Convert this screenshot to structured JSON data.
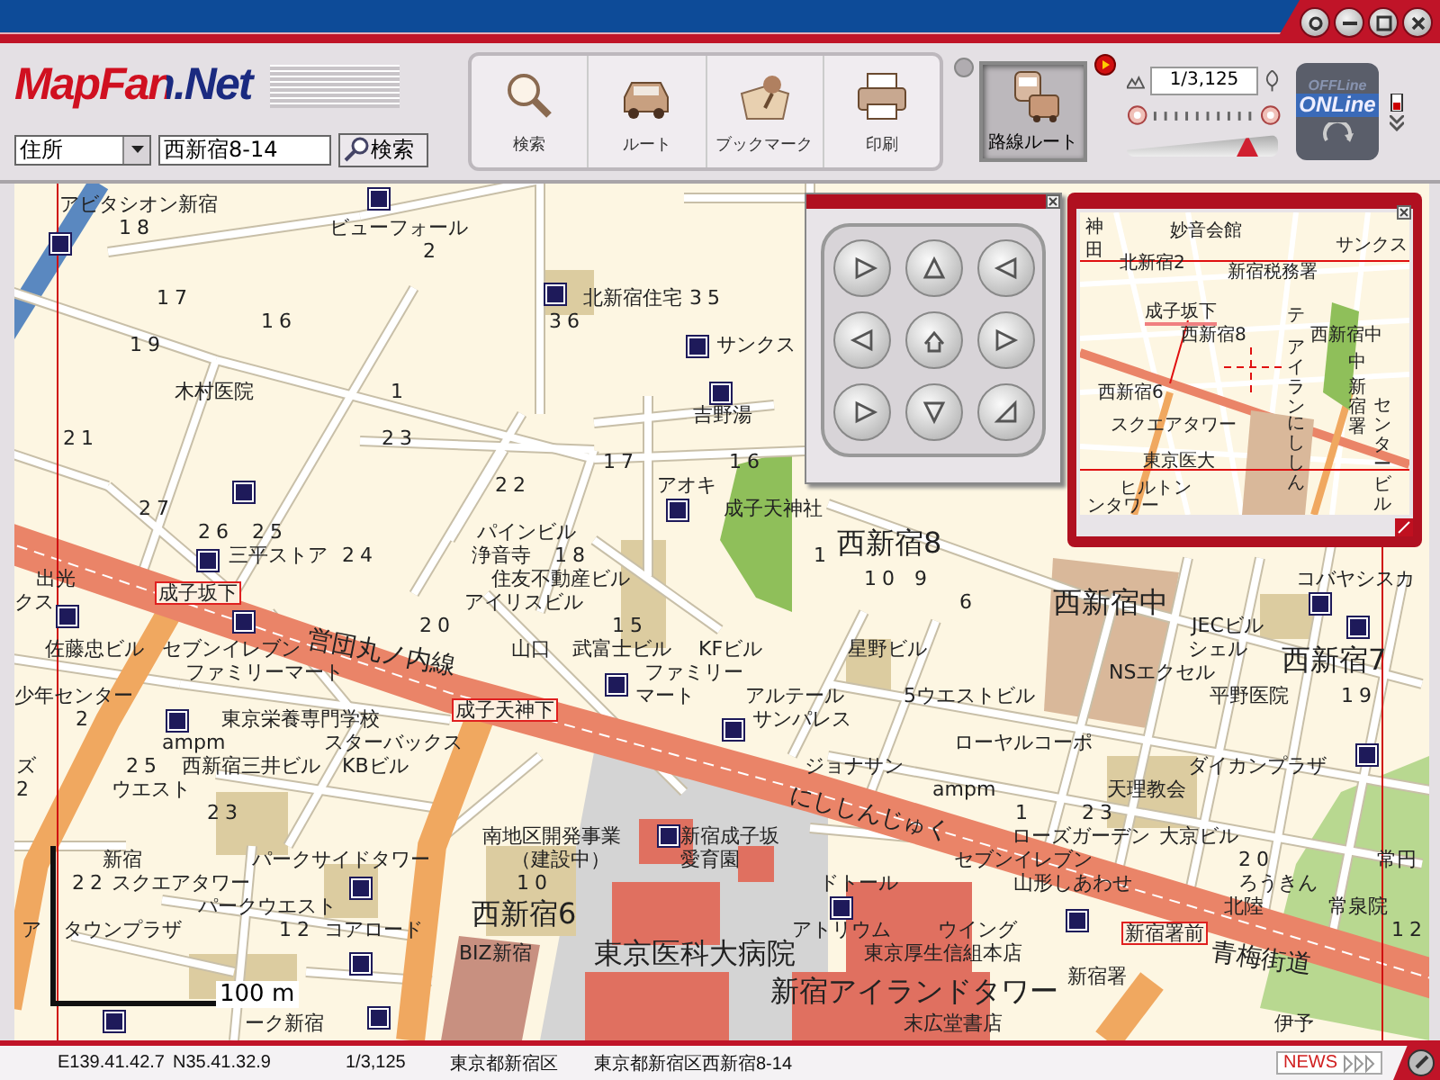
{
  "toolbar": {
    "logo": "MapFan.Net",
    "search_type": "住所",
    "address": "西新宿8-14",
    "search_button": "検索",
    "tools": [
      {
        "label": "検索",
        "kind": "search",
        "selected": false
      },
      {
        "label": "ルート",
        "kind": "route",
        "selected": false
      },
      {
        "label": "ブックマーク",
        "kind": "bookmark",
        "selected": false
      },
      {
        "label": "印刷",
        "kind": "print",
        "selected": false
      },
      {
        "label": "路線ルート",
        "kind": "transit",
        "selected": true
      }
    ],
    "scale": "1/3,125",
    "zoom_slider": {
      "level": 0.8
    },
    "mode_badge": {
      "top": "OFFLine",
      "bottom": "ONLine"
    }
  },
  "map": {
    "labels": [
      {
        "text": "アビタシオン新宿",
        "kind": "place"
      },
      {
        "text": "18",
        "kind": "number"
      },
      {
        "text": "ビューフォール",
        "kind": "place"
      },
      {
        "text": "2",
        "kind": "number"
      },
      {
        "text": "17",
        "kind": "number"
      },
      {
        "text": "北新宿住宅",
        "kind": "place"
      },
      {
        "text": "35",
        "kind": "number"
      },
      {
        "text": "16",
        "kind": "number"
      },
      {
        "text": "36",
        "kind": "number"
      },
      {
        "text": "19",
        "kind": "number"
      },
      {
        "text": "サンクス",
        "kind": "place"
      },
      {
        "text": "木村医院",
        "kind": "place"
      },
      {
        "text": "1",
        "kind": "number"
      },
      {
        "text": "吉野湯",
        "kind": "place"
      },
      {
        "text": "21",
        "kind": "number"
      },
      {
        "text": "23",
        "kind": "number"
      },
      {
        "text": "17",
        "kind": "number"
      },
      {
        "text": "16",
        "kind": "number"
      },
      {
        "text": "22",
        "kind": "number"
      },
      {
        "text": "アオキ",
        "kind": "place"
      },
      {
        "text": "27",
        "kind": "number"
      },
      {
        "text": "成子天神社",
        "kind": "place"
      },
      {
        "text": "26",
        "kind": "number"
      },
      {
        "text": "25",
        "kind": "number"
      },
      {
        "text": "パインビル",
        "kind": "place"
      },
      {
        "text": "三平ストア",
        "kind": "place"
      },
      {
        "text": "24",
        "kind": "number"
      },
      {
        "text": "浄音寺",
        "kind": "place"
      },
      {
        "text": "18",
        "kind": "number"
      },
      {
        "text": "1",
        "kind": "number"
      },
      {
        "text": "出光",
        "kind": "place"
      },
      {
        "text": "住友不動産ビル",
        "kind": "place"
      },
      {
        "text": "10",
        "kind": "number"
      },
      {
        "text": "9",
        "kind": "number"
      },
      {
        "text": "コバヤシスカ",
        "kind": "place"
      },
      {
        "text": "クス",
        "kind": "place"
      },
      {
        "text": "アイリスビル",
        "kind": "place"
      },
      {
        "text": "6",
        "kind": "number"
      },
      {
        "text": "20",
        "kind": "number"
      },
      {
        "text": "15",
        "kind": "number"
      },
      {
        "text": "JECビル",
        "kind": "place"
      },
      {
        "text": "佐藤忠ビル",
        "kind": "place"
      },
      {
        "text": "セブンイレブン",
        "kind": "place"
      },
      {
        "text": "山口",
        "kind": "place"
      },
      {
        "text": "武富士ビル",
        "kind": "place"
      },
      {
        "text": "KFビル",
        "kind": "place"
      },
      {
        "text": "星野ビル",
        "kind": "place"
      },
      {
        "text": "シェル",
        "kind": "place"
      },
      {
        "text": "ファミリーマート",
        "kind": "place"
      },
      {
        "text": "ファミリー",
        "kind": "place"
      },
      {
        "text": "NSエクセル",
        "kind": "place"
      },
      {
        "text": "少年センター",
        "kind": "place"
      },
      {
        "text": "マート",
        "kind": "place"
      },
      {
        "text": "アルテール",
        "kind": "place"
      },
      {
        "text": "5ウエストビル",
        "kind": "place"
      },
      {
        "text": "平野医院",
        "kind": "place"
      },
      {
        "text": "19",
        "kind": "number"
      },
      {
        "text": "2",
        "kind": "number"
      },
      {
        "text": "東京栄養専門学校",
        "kind": "place"
      },
      {
        "text": "サンパレス",
        "kind": "place"
      },
      {
        "text": "ampm",
        "kind": "place"
      },
      {
        "text": "スターバックス",
        "kind": "place"
      },
      {
        "text": "ローヤルコーポ",
        "kind": "place"
      },
      {
        "text": "ズ",
        "kind": "place"
      },
      {
        "text": "25",
        "kind": "number"
      },
      {
        "text": "西新宿三井ビル",
        "kind": "place"
      },
      {
        "text": "KBビル",
        "kind": "place"
      },
      {
        "text": "ジョナサン",
        "kind": "place"
      },
      {
        "text": "ダイカンプラザ",
        "kind": "place"
      },
      {
        "text": "2",
        "kind": "number"
      },
      {
        "text": "ウエスト",
        "kind": "place"
      },
      {
        "text": "ampm",
        "kind": "place"
      },
      {
        "text": "天理教会",
        "kind": "place"
      },
      {
        "text": "23",
        "kind": "number"
      },
      {
        "text": "1",
        "kind": "number"
      },
      {
        "text": "23",
        "kind": "number"
      },
      {
        "text": "南地区開発事業",
        "kind": "place"
      },
      {
        "text": "新宿成子坂",
        "kind": "place"
      },
      {
        "text": "ローズガーデン",
        "kind": "place"
      },
      {
        "text": "大京ビル",
        "kind": "place"
      },
      {
        "text": "新宿",
        "kind": "place"
      },
      {
        "text": "パークサイドタワー",
        "kind": "place"
      },
      {
        "text": "（建設中）",
        "kind": "place"
      },
      {
        "text": "愛育園",
        "kind": "place"
      },
      {
        "text": "セブンイレブン",
        "kind": "place"
      },
      {
        "text": "20",
        "kind": "number"
      },
      {
        "text": "常円",
        "kind": "place"
      },
      {
        "text": "22",
        "kind": "number"
      },
      {
        "text": "スクエアタワー",
        "kind": "place"
      },
      {
        "text": "10",
        "kind": "number"
      },
      {
        "text": "ドトール",
        "kind": "place"
      },
      {
        "text": "山形しあわせ",
        "kind": "place"
      },
      {
        "text": "ろうきん",
        "kind": "place"
      },
      {
        "text": "パークウエスト",
        "kind": "place"
      },
      {
        "text": "北陸",
        "kind": "place"
      },
      {
        "text": "常泉院",
        "kind": "place"
      },
      {
        "text": "ア",
        "kind": "place"
      },
      {
        "text": "タウンプラザ",
        "kind": "place"
      },
      {
        "text": "12",
        "kind": "number"
      },
      {
        "text": "コアロード",
        "kind": "place"
      },
      {
        "text": "アトリウム",
        "kind": "place"
      },
      {
        "text": "ウイング",
        "kind": "place"
      },
      {
        "text": "12",
        "kind": "number"
      },
      {
        "text": "BIZ新宿",
        "kind": "place"
      },
      {
        "text": "東京厚生信組本店",
        "kind": "place"
      },
      {
        "text": "新宿署",
        "kind": "place"
      },
      {
        "text": "ーク新宿",
        "kind": "place"
      },
      {
        "text": "末広堂書店",
        "kind": "place"
      },
      {
        "text": "伊予",
        "kind": "place"
      }
    ],
    "districts": [
      {
        "text": "西新宿8"
      },
      {
        "text": "西新宿中"
      },
      {
        "text": "西新宿7"
      },
      {
        "text": "西新宿6"
      },
      {
        "text": "東京医科大病院"
      },
      {
        "text": "新宿アイランドタワー"
      }
    ],
    "stations": [
      {
        "text": "成子坂下"
      },
      {
        "text": "成子天神下"
      },
      {
        "text": "新宿署前"
      }
    ],
    "roads": [
      {
        "text": "営団丸ノ内線"
      },
      {
        "text": "にししんじゅく"
      },
      {
        "text": "青梅街道"
      }
    ],
    "scale_bar": "100 m"
  },
  "minimap": {
    "labels": [
      {
        "text": "神",
        "kind": "place"
      },
      {
        "text": "田",
        "kind": "place"
      },
      {
        "text": "妙音会館",
        "kind": "place"
      },
      {
        "text": "サンクス",
        "kind": "place"
      },
      {
        "text": "北新宿2",
        "kind": "place"
      },
      {
        "text": "新宿税務署",
        "kind": "place"
      },
      {
        "text": "成子坂下",
        "kind": "station"
      },
      {
        "text": "テ",
        "kind": "place"
      },
      {
        "text": "西新宿8",
        "kind": "place"
      },
      {
        "text": "西新宿中",
        "kind": "place"
      },
      {
        "text": "西新宿6",
        "kind": "place"
      },
      {
        "text": "スクエアタワー",
        "kind": "place"
      },
      {
        "text": "東京医大",
        "kind": "place"
      },
      {
        "text": "ヒルトン",
        "kind": "place"
      },
      {
        "text": "ンタワー",
        "kind": "place"
      },
      {
        "text": "アイラン",
        "kind": "vertical"
      },
      {
        "text": "にししん",
        "kind": "vertical"
      },
      {
        "text": "中",
        "kind": "place"
      },
      {
        "text": "新宿署",
        "kind": "vertical"
      },
      {
        "text": "センタービル",
        "kind": "vertical"
      }
    ]
  },
  "status_bar": {
    "longitude": "E139.41.42.7",
    "latitude": "N35.41.32.9",
    "scale": "1/3,125",
    "ward": "東京都新宿区",
    "address": "東京都新宿区西新宿8-14",
    "news": "NEWS"
  }
}
